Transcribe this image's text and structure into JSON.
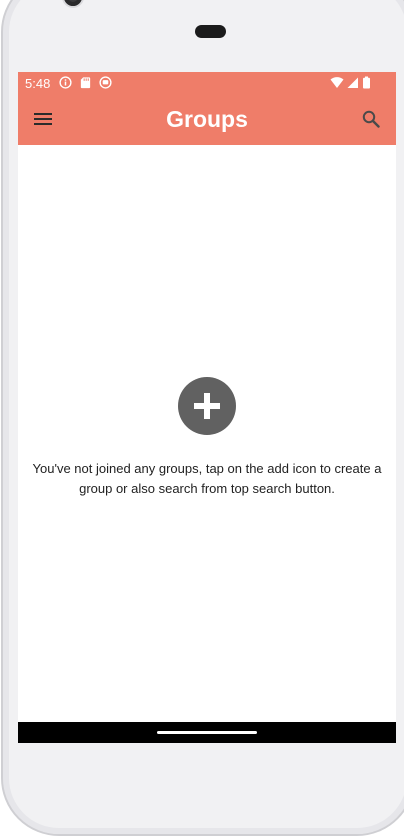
{
  "status_bar": {
    "time": "5:48",
    "background_color": "#ef7d69",
    "left_icons": [
      "info-icon",
      "sd-card-icon",
      "record-icon"
    ],
    "right_icons": [
      "wifi-icon",
      "cell-signal-icon",
      "battery-icon"
    ]
  },
  "app_bar": {
    "title": "Groups",
    "menu_icon": "menu-icon",
    "search_icon": "search-icon"
  },
  "empty_state": {
    "icon": "add-circle-icon",
    "message": "You've not joined any groups, tap on the add icon to create a group or also search from top search button."
  },
  "fab": {
    "icon": "plus-icon",
    "color": "#ef7d69"
  }
}
